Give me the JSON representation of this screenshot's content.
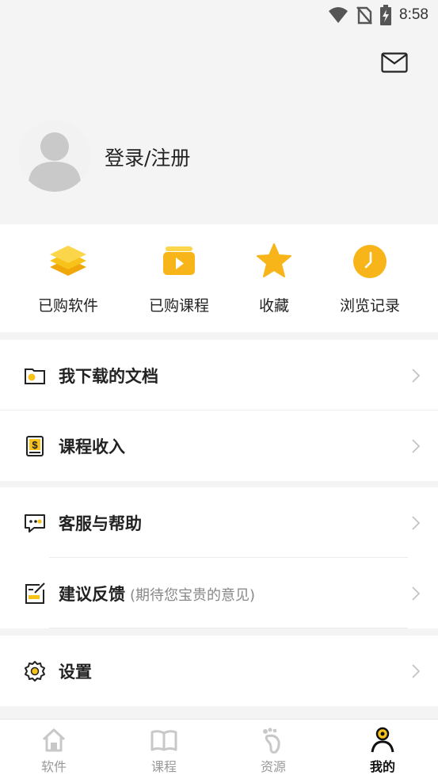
{
  "status_bar": {
    "time": "8:58",
    "icons": [
      "wifi-icon",
      "no-sim-icon",
      "battery-charging-icon"
    ]
  },
  "header": {
    "mail_icon": "mail-icon",
    "avatar_icon": "default-avatar",
    "login_label": "登录/注册"
  },
  "quick_actions": [
    {
      "label": "已购软件",
      "icon": "layers-icon"
    },
    {
      "label": "已购课程",
      "icon": "video-course-icon"
    },
    {
      "label": "收藏",
      "icon": "star-icon"
    },
    {
      "label": "浏览记录",
      "icon": "clock-icon"
    }
  ],
  "menu": {
    "downloads": {
      "label": "我下载的文档",
      "icon": "folder-icon"
    },
    "income": {
      "label": "课程收入",
      "icon": "dollar-book-icon"
    },
    "support": {
      "label": "客服与帮助",
      "icon": "chat-bubble-icon"
    },
    "feedback": {
      "label": "建议反馈",
      "hint": "(期待您宝贵的意见)",
      "icon": "edit-note-icon"
    },
    "settings": {
      "label": "设置",
      "icon": "gear-icon"
    }
  },
  "bottom_nav": [
    {
      "label": "软件",
      "icon": "home-icon"
    },
    {
      "label": "课程",
      "icon": "book-icon"
    },
    {
      "label": "资源",
      "icon": "footprint-icon"
    },
    {
      "label": "我的",
      "icon": "person-icon",
      "active": true
    }
  ],
  "colors": {
    "accent": "#f7c21a",
    "accent_dark": "#f0a70a",
    "active_text": "#111111",
    "inactive_text": "#999999"
  }
}
